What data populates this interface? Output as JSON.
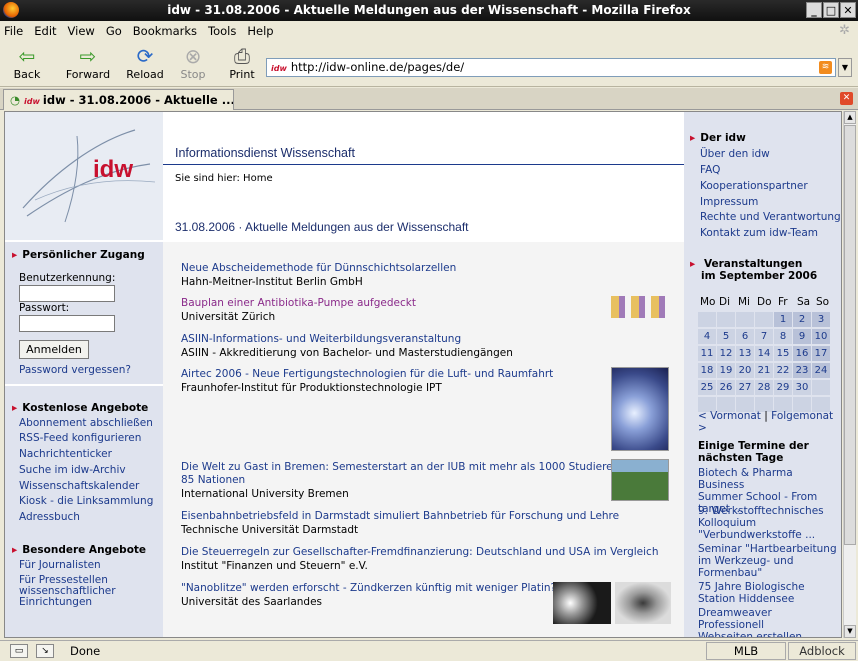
{
  "window": {
    "title": "idw - 31.08.2006 - Aktuelle Meldungen aus der Wissenschaft - Mozilla Firefox"
  },
  "menu": [
    "File",
    "Edit",
    "View",
    "Go",
    "Bookmarks",
    "Tools",
    "Help"
  ],
  "toolbar": {
    "back": "Back",
    "forward": "Forward",
    "reload": "Reload",
    "stop": "Stop",
    "print": "Print"
  },
  "url": {
    "fav": "idw",
    "value": "http://idw-online.de/pages/de/"
  },
  "tab": {
    "fav": "idw",
    "label": "idw - 31.08.2006 - Aktuelle ..."
  },
  "status": {
    "text": "Done",
    "zone": "MLB",
    "addon": "Adblock"
  },
  "left": {
    "logo_text": "idw",
    "login": {
      "heading": "Persönlicher Zugang",
      "user_label": "Benutzerkennung:",
      "pass_label": "Passwort:",
      "button": "Anmelden",
      "forgot": "Password vergessen?"
    },
    "free": {
      "heading": "Kostenlose Angebote",
      "items": [
        "Abonnement abschließen",
        "RSS-Feed konfigurieren",
        "Nachrichtenticker",
        "Suche im idw-Archiv",
        "Wissenschaftskalender",
        "Kiosk - die Linksammlung",
        "Adressbuch"
      ]
    },
    "special": {
      "heading": "Besondere Angebote",
      "items": [
        "Für Journalisten",
        "Für Pressestellen",
        "wissenschaftlicher",
        "Einrichtungen"
      ]
    }
  },
  "main": {
    "title": "Informationsdienst Wissenschaft",
    "breadcrumb": "Sie sind hier: Home",
    "date_title": "31.08.2006 · Aktuelle Meldungen aus der Wissenschaft",
    "news": [
      {
        "title": "Neue Abscheidemethode für Dünnschichtsolarzellen",
        "source": "Hahn-Meitner-Institut Berlin GmbH"
      },
      {
        "title": "Bauplan einer Antibiotika-Pumpe aufgedeckt",
        "source": "Universität Zürich"
      },
      {
        "title": "ASIIN-Informations- und Weiterbildungsveranstaltung",
        "source": "ASIIN - Akkreditierung von Bachelor- und Masterstudiengängen"
      },
      {
        "title": "Airtec 2006 - Neue Fertigungstechnologien für die Luft- und Raumfahrt",
        "source": "Fraunhofer-Institut für Produktionstechnologie IPT"
      },
      {
        "title": "Die Welt zu Gast in Bremen: Semesterstart an der IUB mit mehr als 1000 Studierenden aus",
        "title2": "85 Nationen",
        "source": "International University Bremen"
      },
      {
        "title": "Eisenbahnbetriebsfeld in Darmstadt simuliert Bahnbetrieb für Forschung und Lehre",
        "source": "Technische Universität Darmstadt"
      },
      {
        "title": "Die Steuerregeln zur Gesellschafter-Fremdfinanzierung: Deutschland und USA im Vergleich",
        "source": "Institut \"Finanzen und Steuern\" e.V."
      },
      {
        "title": "\"Nanoblitze\" werden erforscht - Zündkerzen künftig mit weniger Platin?",
        "source": "Universität des Saarlandes"
      }
    ]
  },
  "right": {
    "idw": {
      "heading": "Der idw",
      "items": [
        "Über den idw",
        "FAQ",
        "Kooperationspartner",
        "Impressum",
        "Rechte und Verantwortung",
        "Kontakt zum idw-Team"
      ]
    },
    "events": {
      "heading1": "Veranstaltungen",
      "heading2": "im September 2006",
      "weekdays": [
        "Mo",
        "Di",
        "Mi",
        "Do",
        "Fr",
        "Sa",
        "So"
      ],
      "weeks": [
        [
          "",
          "",
          "",
          "",
          "1",
          "2",
          "3"
        ],
        [
          "4",
          "5",
          "6",
          "7",
          "8",
          "9",
          "10"
        ],
        [
          "11",
          "12",
          "13",
          "14",
          "15",
          "16",
          "17"
        ],
        [
          "18",
          "19",
          "20",
          "21",
          "22",
          "23",
          "24"
        ],
        [
          "25",
          "26",
          "27",
          "28",
          "29",
          "30",
          ""
        ],
        [
          "",
          "",
          "",
          "",
          "",
          "",
          ""
        ]
      ],
      "prev": "< Vormonat",
      "sep": "|",
      "next": "Folgemonat >"
    },
    "upcoming": {
      "heading": "Einige Termine der nächsten Tage",
      "items": [
        [
          "Biotech & Pharma Business",
          "Summer School - From",
          "target ..."
        ],
        [
          "9. Werkstofftechnisches",
          "Kolloquium",
          "\"Verbundwerkstoffe ..."
        ],
        [
          "Seminar \"Hartbearbeitung",
          "im Werkzeug- und",
          "Formenbau\""
        ],
        [
          "75 Jahre Biologische",
          "Station Hiddensee"
        ],
        [
          "Dreamweaver Professionell",
          "Webseiten erstellen"
        ]
      ]
    }
  }
}
